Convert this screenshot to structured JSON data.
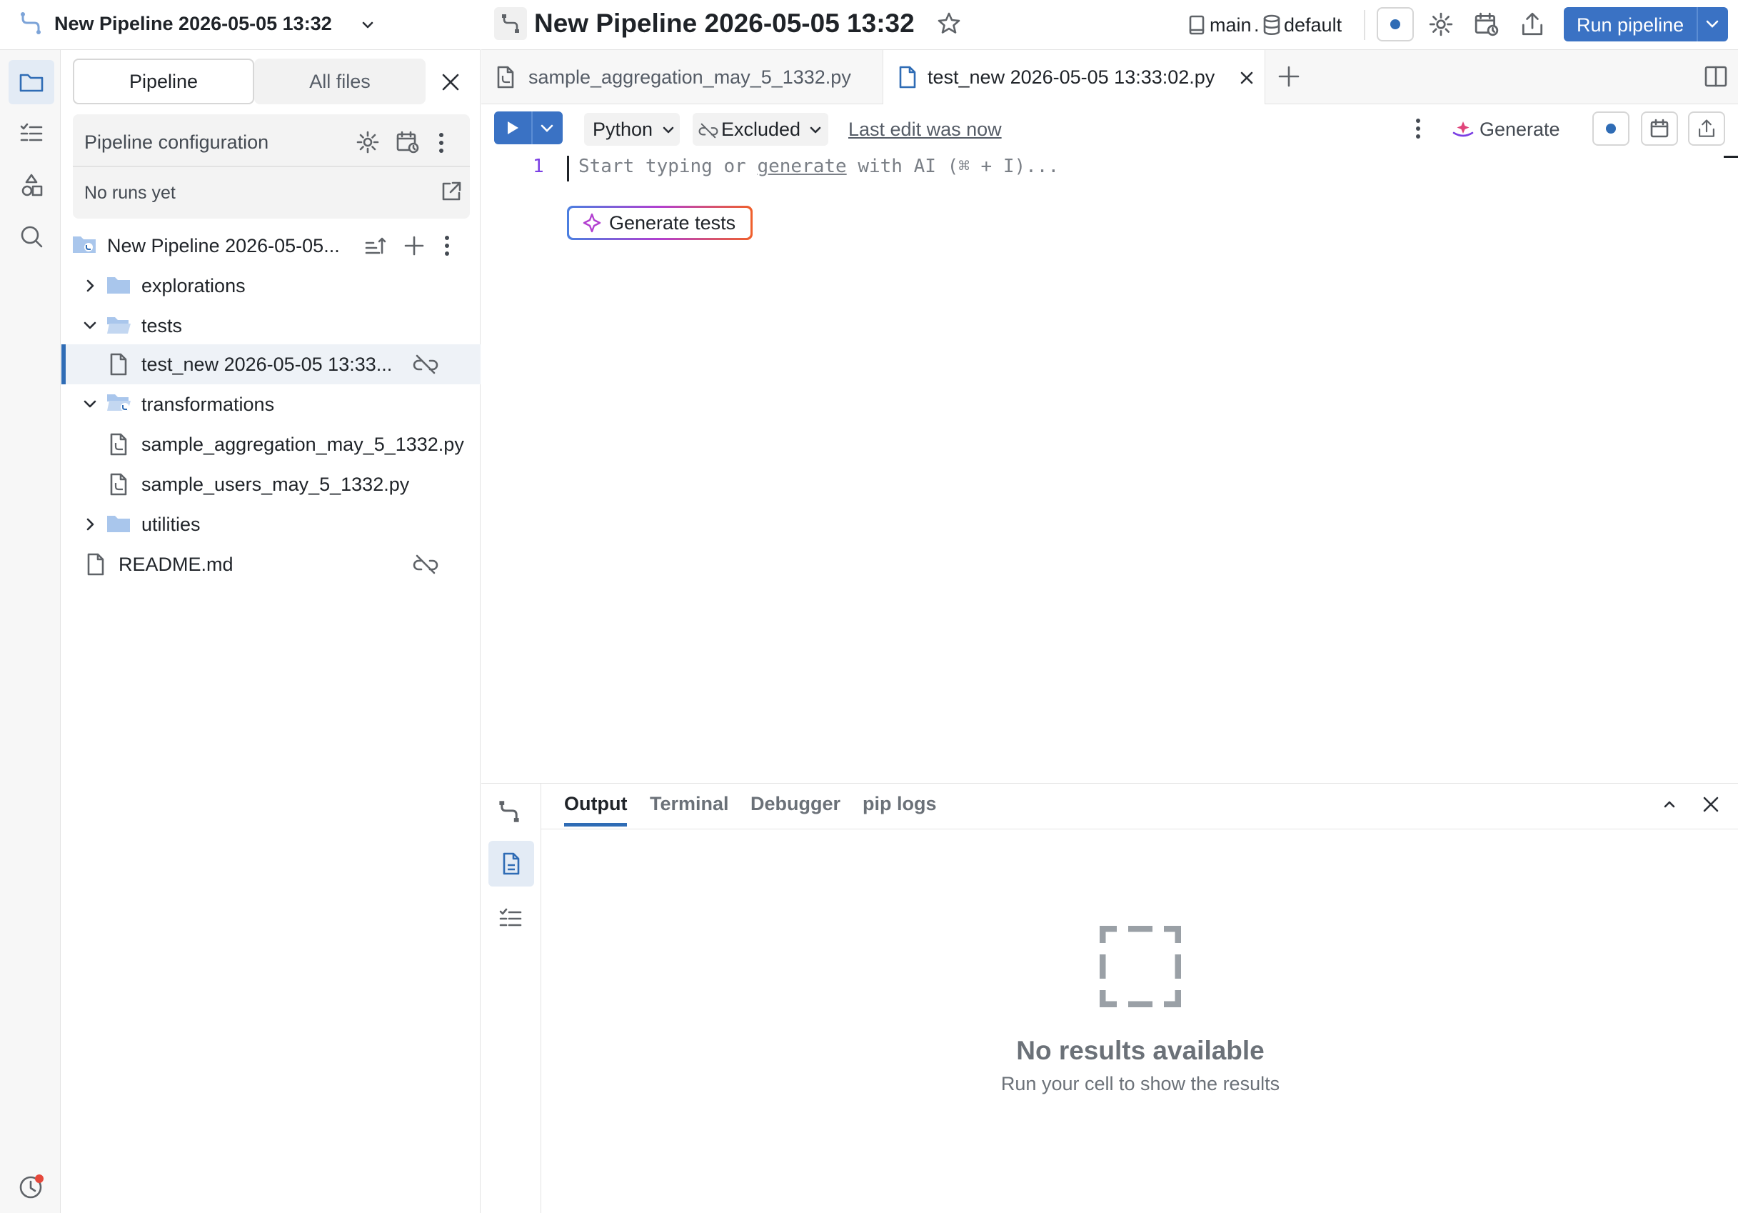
{
  "header": {
    "pipeline_name": "New Pipeline 2026-05-05 13:32",
    "title": "New Pipeline 2026-05-05 13:32",
    "branch": "main",
    "separator": ".",
    "schema": "default",
    "run_label": "Run pipeline"
  },
  "explorer": {
    "tab_pipeline": "Pipeline",
    "tab_all_files": "All files",
    "config_label": "Pipeline configuration",
    "no_runs": "No runs yet",
    "root_name": "New Pipeline 2026-05-05...",
    "tree": {
      "explorations": "explorations",
      "tests": "tests",
      "test_file": "test_new 2026-05-05 13:33...",
      "transformations": "transformations",
      "agg_file": "sample_aggregation_may_5_1332.py",
      "users_file": "sample_users_may_5_1332.py",
      "utilities": "utilities",
      "readme": "README.md"
    }
  },
  "tabs": {
    "tab1": "sample_aggregation_may_5_1332.py",
    "tab2": "test_new 2026-05-05 13:33:02.py"
  },
  "toolbar": {
    "language": "Python",
    "excluded": "Excluded",
    "last_edit": "Last edit was now",
    "generate": "Generate"
  },
  "editor": {
    "line_number": "1",
    "placeholder_start": "Start typing or ",
    "placeholder_link": "generate",
    "placeholder_end": " with AI (⌘ + I)...",
    "generate_tests": "Generate tests"
  },
  "output": {
    "tabs": [
      "Output",
      "Terminal",
      "Debugger",
      "pip logs"
    ],
    "empty_title": "No results available",
    "empty_sub": "Run your cell to show the results"
  },
  "colors": {
    "accent": "#2f6cb5",
    "run_button": "#3a72c4",
    "notification_dot": "#e5483b"
  }
}
